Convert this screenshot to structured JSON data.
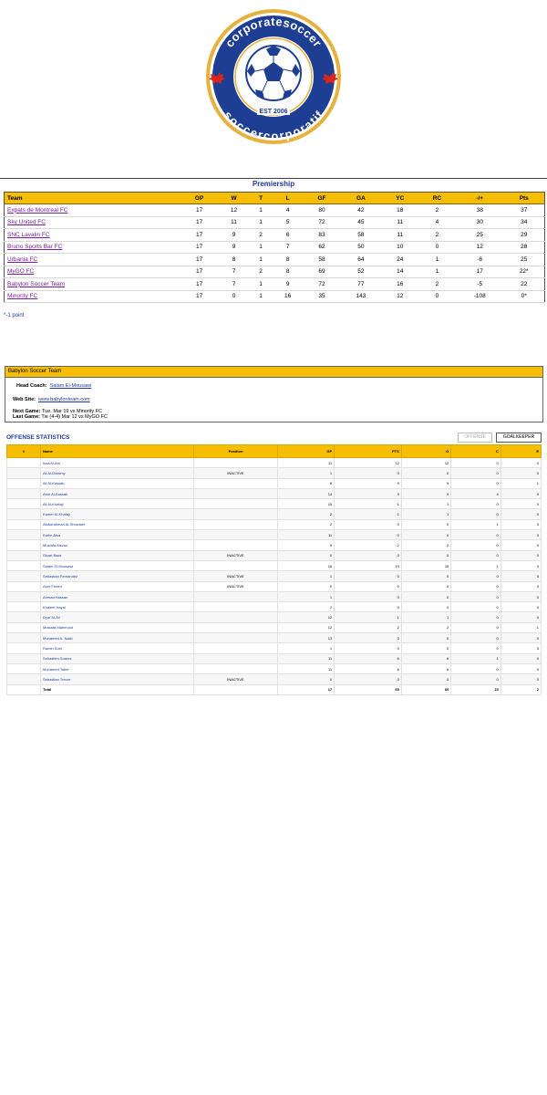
{
  "logo": {
    "top_text": "corporatesoccer",
    "bottom_text": "soccercorporatif",
    "est": "EST 2006",
    "colors": {
      "navy": "#1e3e93",
      "gold": "#e6b13c",
      "red": "#d8261d"
    }
  },
  "premiership": {
    "title": "Premiership",
    "headers": [
      "Team",
      "GP",
      "W",
      "T",
      "L",
      "GF",
      "GA",
      "YC",
      "RC",
      "-/+",
      "Pts"
    ],
    "rows": [
      {
        "team": "Expats de Montreal FC",
        "gp": "17",
        "w": "12",
        "t": "1",
        "l": "4",
        "gf": "80",
        "ga": "42",
        "yc": "18",
        "rc": "2",
        "diff": "38",
        "pts": "37"
      },
      {
        "team": "Sky United FC",
        "gp": "17",
        "w": "11",
        "t": "1",
        "l": "5",
        "gf": "72",
        "ga": "45",
        "yc": "11",
        "rc": "4",
        "diff": "30",
        "pts": "34"
      },
      {
        "team": "SNC Lavalin FC",
        "gp": "17",
        "w": "9",
        "t": "2",
        "l": "6",
        "gf": "83",
        "ga": "58",
        "yc": "11",
        "rc": "2",
        "diff": "25",
        "pts": "29"
      },
      {
        "team": "Bruno Sports Bar FC",
        "gp": "17",
        "w": "9",
        "t": "1",
        "l": "7",
        "gf": "62",
        "ga": "50",
        "yc": "10",
        "rc": "0",
        "diff": "12",
        "pts": "28"
      },
      {
        "team": "Urbania FC",
        "gp": "17",
        "w": "8",
        "t": "1",
        "l": "8",
        "gf": "58",
        "ga": "64",
        "yc": "24",
        "rc": "1",
        "diff": "-6",
        "pts": "25"
      },
      {
        "team": "MyGO FC",
        "gp": "17",
        "w": "7",
        "t": "2",
        "l": "8",
        "gf": "69",
        "ga": "52",
        "yc": "14",
        "rc": "1",
        "diff": "17",
        "pts": "22*"
      },
      {
        "team": "Babylon Soccer Team",
        "gp": "17",
        "w": "7",
        "t": "1",
        "l": "9",
        "gf": "72",
        "ga": "77",
        "yc": "16",
        "rc": "2",
        "diff": "-5",
        "pts": "22"
      },
      {
        "team": "Minority FC",
        "gp": "17",
        "w": "0",
        "t": "1",
        "l": "16",
        "gf": "35",
        "ga": "143",
        "yc": "12",
        "rc": "0",
        "diff": "-108",
        "pts": "0*"
      }
    ],
    "footnote": "*-1 point"
  },
  "team_info": {
    "name": "Babylon Soccer Team",
    "head_coach_label": "Head Coach:",
    "head_coach": "Salam El-Mousawi",
    "website_label": "Web Site:",
    "website": "www.babylonteam.com",
    "next_game_label": "Next Game:",
    "next_game": "Tue. Mar 19 vs Minority FC",
    "last_game_label": "Last Game:",
    "last_game": "Tie (4-4) Mar 12 vs MyGO FC"
  },
  "offense": {
    "title": "OFFENSE STATISTICS",
    "offense_button": "OFFENSE",
    "goalkeeper_button": "GOALKEEPER",
    "headers": [
      "#",
      "Name",
      "Position",
      "GP",
      "PTS",
      "G",
      "C",
      "E"
    ],
    "rows": [
      {
        "num": "",
        "name": "Issa Al-Ani",
        "pos": "",
        "gp": "11",
        "pts": "12",
        "g": "12",
        "c": "0",
        "e": "0"
      },
      {
        "num": "",
        "name": "Ali Al-Dulaimy",
        "pos": "INACTIVE",
        "gp": "1",
        "pts": "0",
        "g": "0",
        "c": "0",
        "e": "0"
      },
      {
        "num": "",
        "name": "Ali Al-Kassab",
        "pos": "",
        "gp": "8",
        "pts": "9",
        "g": "9",
        "c": "0",
        "e": "1"
      },
      {
        "num": "",
        "name": "Amir Al-Kassab",
        "pos": "",
        "gp": "14",
        "pts": "9",
        "g": "9",
        "c": "4",
        "e": "0"
      },
      {
        "num": "",
        "name": "Ali Al-Khafaji",
        "pos": "",
        "gp": "15",
        "pts": "1",
        "g": "1",
        "c": "0",
        "e": "0"
      },
      {
        "num": "",
        "name": "Kamer Al-Khafaji",
        "pos": "",
        "gp": "2",
        "pts": "1",
        "g": "1",
        "c": "0",
        "e": "0"
      },
      {
        "num": "",
        "name": "Abdulrahman Al-Showaier",
        "pos": "",
        "gp": "2",
        "pts": "0",
        "g": "0",
        "c": "1",
        "e": "0"
      },
      {
        "num": "",
        "name": "Karim Alsa",
        "pos": "",
        "gp": "11",
        "pts": "0",
        "g": "0",
        "c": "0",
        "e": "0"
      },
      {
        "num": "",
        "name": "Mustafa Alsvan",
        "pos": "",
        "gp": "9",
        "pts": "2",
        "g": "2",
        "c": "0",
        "e": "0"
      },
      {
        "num": "",
        "name": "Ghazi Bazir",
        "pos": "INACTIVE",
        "gp": "0",
        "pts": "0",
        "g": "0",
        "c": "0",
        "e": "0"
      },
      {
        "num": "",
        "name": "Salam El-Mousawi",
        "pos": "",
        "gp": "16",
        "pts": "19",
        "g": "19",
        "c": "1",
        "e": "0"
      },
      {
        "num": "",
        "name": "Sebastian Fernandez",
        "pos": "INACTIVE",
        "gp": "1",
        "pts": "0",
        "g": "0",
        "c": "0",
        "e": "0"
      },
      {
        "num": "",
        "name": "Azer Fereid",
        "pos": "INACTIVE",
        "gp": "0",
        "pts": "0",
        "g": "0",
        "c": "0",
        "e": "0"
      },
      {
        "num": "",
        "name": "Ahmad Hassan",
        "pos": "",
        "gp": "1",
        "pts": "0",
        "g": "0",
        "c": "0",
        "e": "0"
      },
      {
        "num": "",
        "name": "Khaleel Hayal",
        "pos": "",
        "gp": "2",
        "pts": "0",
        "g": "0",
        "c": "0",
        "e": "0"
      },
      {
        "num": "",
        "name": "Dyar M-Ali",
        "pos": "",
        "gp": "12",
        "pts": "1",
        "g": "1",
        "c": "0",
        "e": "0"
      },
      {
        "num": "",
        "name": "Mostafa Mahmood",
        "pos": "",
        "gp": "12",
        "pts": "2",
        "g": "2",
        "c": "0",
        "e": "1"
      },
      {
        "num": "",
        "name": "Mohamed A. Naiki",
        "pos": "",
        "gp": "13",
        "pts": "0",
        "g": "0",
        "c": "0",
        "e": "0"
      },
      {
        "num": "",
        "name": "Ramin Sobi",
        "pos": "",
        "gp": "1",
        "pts": "0",
        "g": "0",
        "c": "0",
        "e": "0"
      },
      {
        "num": "",
        "name": "Sebastien Suarez",
        "pos": "",
        "gp": "11",
        "pts": "6",
        "g": "6",
        "c": "1",
        "e": "0"
      },
      {
        "num": "",
        "name": "Mohamed Taher",
        "pos": "",
        "gp": "11",
        "pts": "6",
        "g": "6",
        "c": "0",
        "e": "0"
      },
      {
        "num": "",
        "name": "Sebastian Treore",
        "pos": "INACTIVE",
        "gp": "0",
        "pts": "0",
        "g": "0",
        "c": "0",
        "e": "0"
      }
    ],
    "total": {
      "num": "",
      "name": "Total",
      "pos": "",
      "gp": "17",
      "pts": "69",
      "g": "69",
      "c": "15",
      "e": "2"
    }
  }
}
